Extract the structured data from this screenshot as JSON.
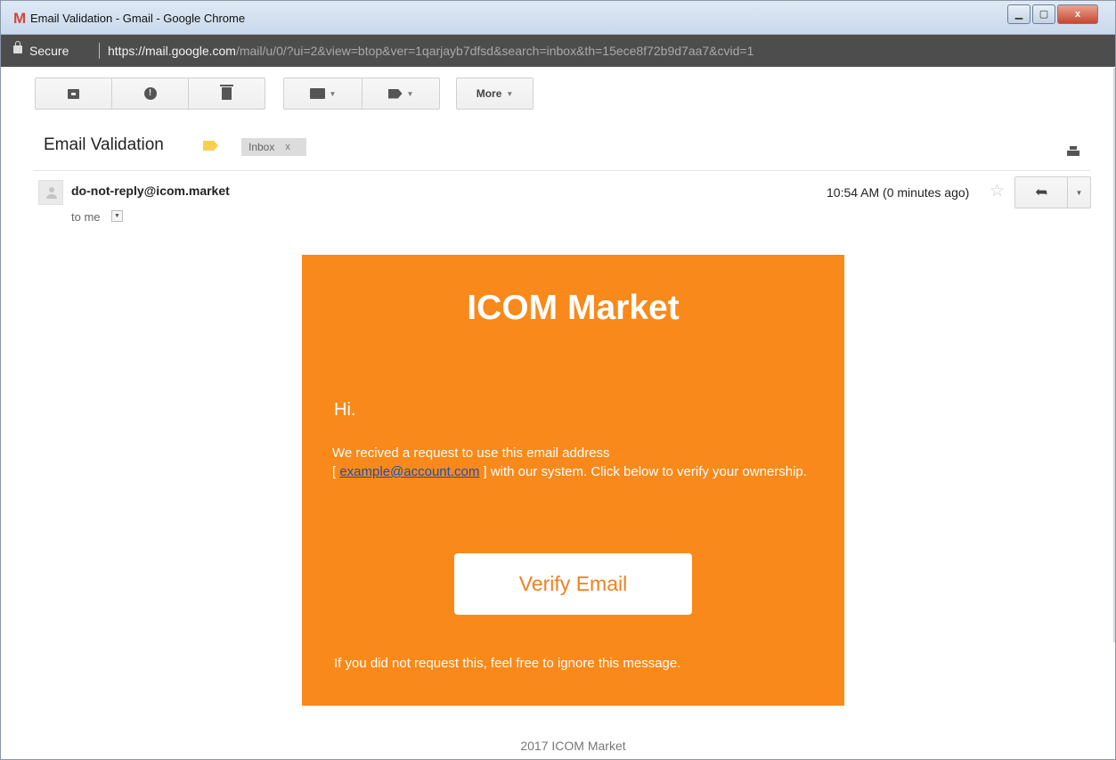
{
  "window": {
    "title": "Email Validation - Gmail - Google Chrome",
    "favicon": "M",
    "controls": [
      "minimize-icon",
      "maximize-icon",
      "close-icon"
    ],
    "close_label": "x"
  },
  "address_bar": {
    "secure_label": "Secure",
    "url_host": "https://mail.google.com",
    "url_path": "/mail/u/0/?ui=2&view=btop&ver=1qarjayb7dfsd&search=inbox&th=15ece8f72b9d7aa7&cvid=1"
  },
  "toolbar": {
    "icons": [
      "archive-icon",
      "spam-icon",
      "trash-icon",
      "folder-icon",
      "label-icon"
    ],
    "spam_glyph": "!",
    "more_label": "More"
  },
  "thread": {
    "subject": "Email Validation",
    "label_chip": "Inbox",
    "label_chip_remove": "x"
  },
  "message": {
    "sender": "do-not-reply@icom.market",
    "recipient": "to me",
    "timestamp": "10:54 AM (0 minutes ago)",
    "star_glyph": "☆",
    "reply_glyph": "➦"
  },
  "email": {
    "brand": "ICOM Market",
    "greeting": "Hi.",
    "text_before_link": "We recived a request to use this email address",
    "bracket_open": "[",
    "link_text": "example@account.com",
    "text_after_link": "] with our system. Click below to verify your ownership.",
    "verify_button": "Verify Email",
    "ignore_text": "If you did not request this, feel free to ignore this message.",
    "footer": "2017 ICOM Market",
    "accent_color": "#f8891a"
  }
}
